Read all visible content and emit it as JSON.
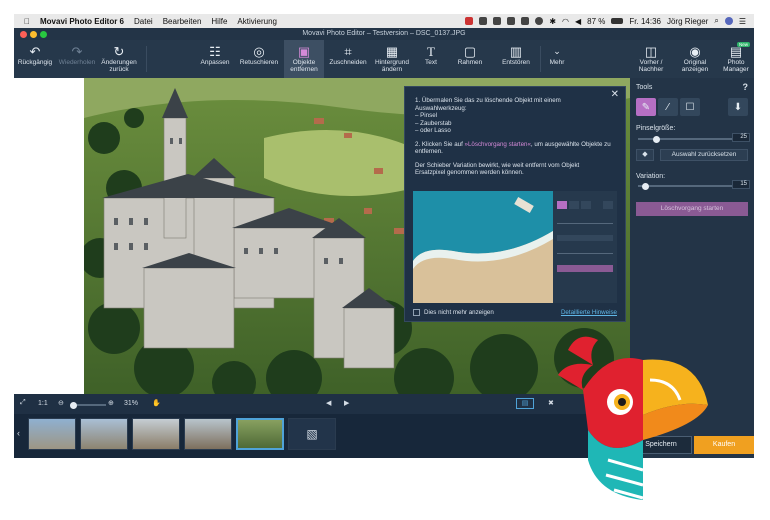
{
  "menubar": {
    "app_name": "Movavi Photo Editor 6",
    "menus": [
      "Datei",
      "Bearbeiten",
      "Hilfe",
      "Aktivierung"
    ],
    "battery": "87 %",
    "clock": "Fr. 14:36",
    "user": "Jörg Rieger"
  },
  "window": {
    "title": "Movavi Photo Editor – Testversion – DSC_0137.JPG"
  },
  "toolbar": {
    "undo": "Rückgängig",
    "redo": "Wiederholen",
    "revert": "Änderungen zurück",
    "adjust": "Anpassen",
    "retouch": "Retuschieren",
    "remove_objects": "Objekte entfernen",
    "crop": "Zuschneiden",
    "change_background": "Hintergrund ändern",
    "text": "Text",
    "frames": "Rahmen",
    "denoise": "Entstören",
    "more": "Mehr",
    "before_after": "Vorher / Nachher",
    "show_original": "Original anzeigen",
    "photo_manager": "Photo Manager",
    "new_badge": "New"
  },
  "tip": {
    "step1": "1. Übermalen Sie das zu löschende Objekt mit einem Auswahlwerkzeug:",
    "opt1": "– Pinsel",
    "opt2": "– Zauberstab",
    "opt3": "– oder Lasso",
    "step2_pre": "2. Klicken Sie auf ",
    "step2_link": "»Löschvorgang starten«",
    "step2_post": ", um ausgewählte Objekte zu entfernen.",
    "variation_note": "Der Schieber Variation bewirkt, wie weit entfernt vom Objekt Ersatzpixel genommen werden können.",
    "dont_show": "Dies nicht mehr anzeigen",
    "details_link": "Detaillierte Hinweise"
  },
  "panel": {
    "tools_label": "Tools",
    "help": "?",
    "brush_size_label": "Pinselgröße:",
    "brush_size_value": "25",
    "brush_size_fraction": 0.2,
    "reset_selection": "Auswahl zurücksetzen",
    "variation_label": "Variation:",
    "variation_value": "15",
    "variation_fraction": 0.08,
    "start_erase": "Löschvorgang starten",
    "save": "Speichern",
    "buy": "Kaufen"
  },
  "bottombar": {
    "ratio": "1:1",
    "zoom": "31%",
    "zoom_fraction": 0.1
  },
  "colors": {
    "accent_purple": "#b66fc4",
    "buy_orange": "#f0a020",
    "selection_blue": "#4fa3d8"
  }
}
